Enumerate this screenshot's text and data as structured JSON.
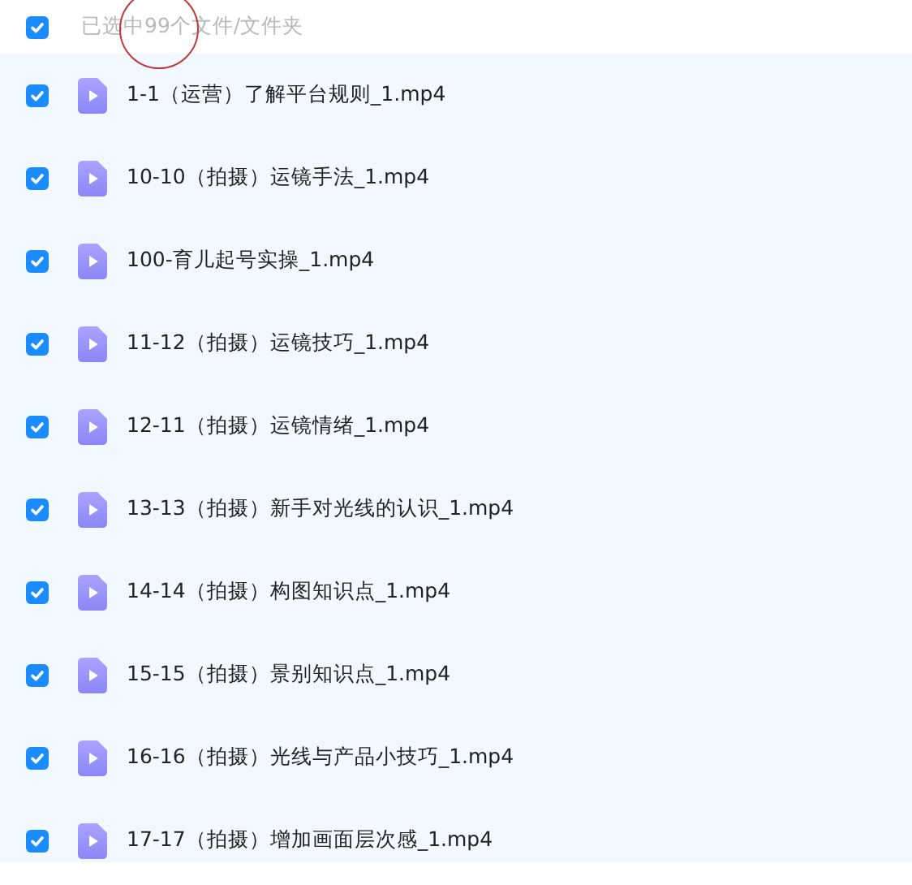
{
  "header": {
    "checked": true,
    "label": "已选中99个文件/文件夹"
  },
  "annotation_circle": true,
  "files": [
    {
      "name": "1-1（运营）了解平台规则_1.mp4",
      "checked": true
    },
    {
      "name": "10-10（拍摄）运镜手法_1.mp4",
      "checked": true
    },
    {
      "name": "100-育儿起号实操_1.mp4",
      "checked": true
    },
    {
      "name": "11-12（拍摄）运镜技巧_1.mp4",
      "checked": true
    },
    {
      "name": "12-11（拍摄）运镜情绪_1.mp4",
      "checked": true
    },
    {
      "name": "13-13（拍摄）新手对光线的认识_1.mp4",
      "checked": true
    },
    {
      "name": "14-14（拍摄）构图知识点_1.mp4",
      "checked": true
    },
    {
      "name": "15-15（拍摄）景别知识点_1.mp4",
      "checked": true
    },
    {
      "name": "16-16（拍摄）光线与产品小技巧_1.mp4",
      "checked": true
    },
    {
      "name": "17-17（拍摄）增加画面层次感_1.mp4",
      "checked": true
    }
  ]
}
